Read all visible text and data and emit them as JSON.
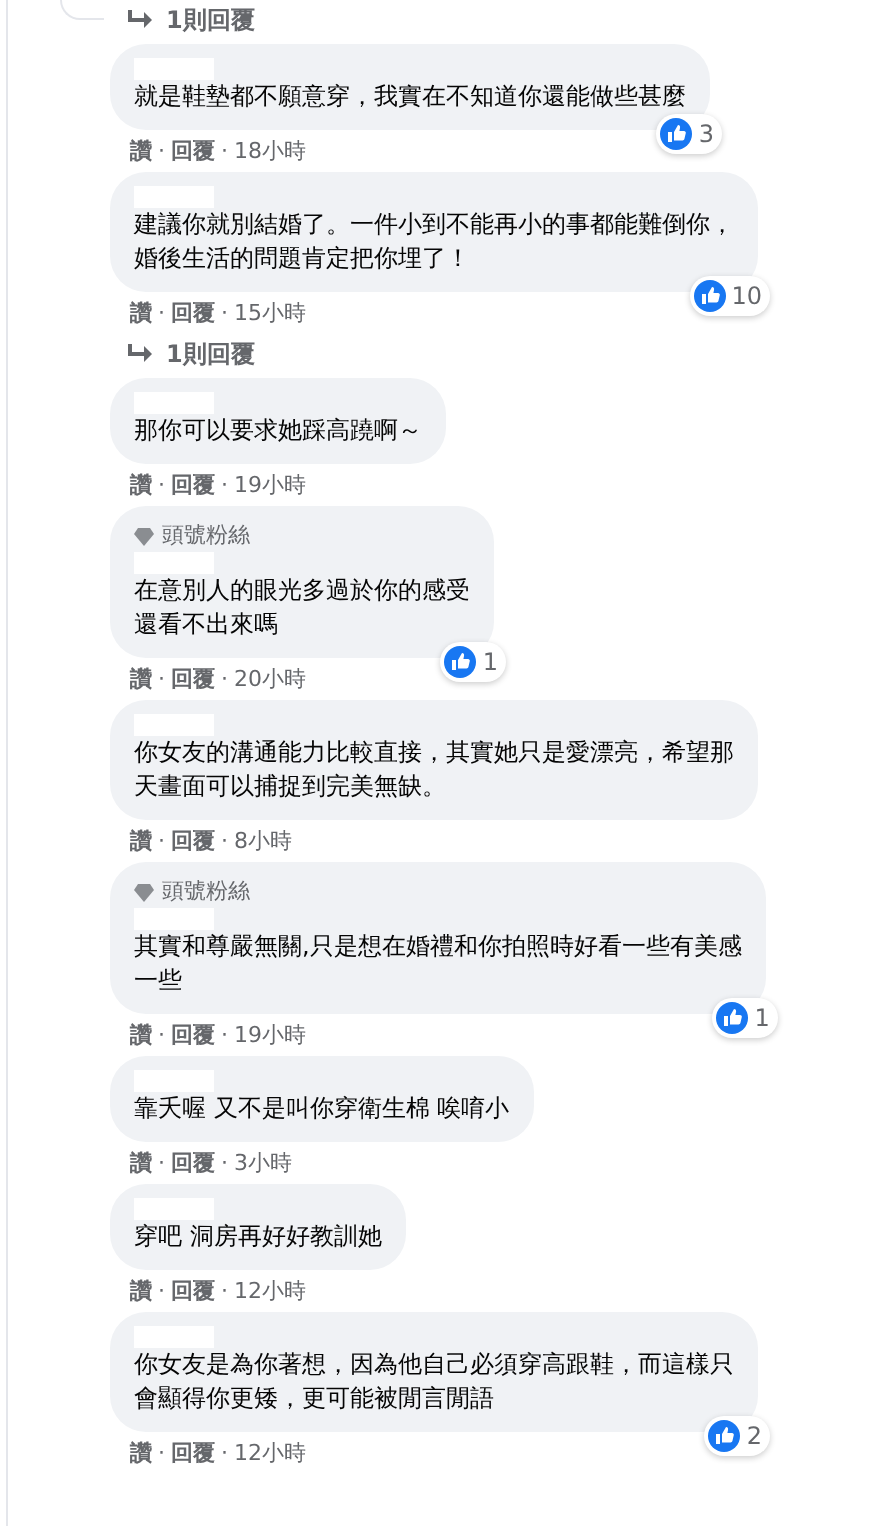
{
  "thread": [
    {
      "kind": "replies",
      "label": "1則回覆"
    },
    {
      "kind": "comment",
      "lines": [
        "就是鞋墊都不願意穿，我實在不知道你還能做些甚麼"
      ],
      "actions": [
        "讚",
        "回覆"
      ],
      "sep": "·",
      "time": "18小時",
      "likes": "3"
    },
    {
      "kind": "comment",
      "lines": [
        "建議你就別結婚了。一件小到不能再小的事都能難倒你，",
        "婚後生活的問題肯定把你埋了！"
      ],
      "actions": [
        "讚",
        "回覆"
      ],
      "sep": "·",
      "time": "15小時",
      "likes": "10"
    },
    {
      "kind": "replies",
      "label": "1則回覆"
    },
    {
      "kind": "comment",
      "lines": [
        "那你可以要求她踩高蹺啊～"
      ],
      "actions": [
        "讚",
        "回覆"
      ],
      "sep": "·",
      "time": "19小時"
    },
    {
      "kind": "comment",
      "badge": "頭號粉絲",
      "lines": [
        "在意別人的眼光多過於你的感受",
        "還看不出來嗎"
      ],
      "actions": [
        "讚",
        "回覆"
      ],
      "sep": "·",
      "time": "20小時",
      "likes": "1"
    },
    {
      "kind": "comment",
      "lines": [
        "你女友的溝通能力比較直接，其實她只是愛漂亮，希望那",
        "天畫面可以捕捉到完美無缺。"
      ],
      "actions": [
        "讚",
        "回覆"
      ],
      "sep": "·",
      "time": "8小時"
    },
    {
      "kind": "comment",
      "badge": "頭號粉絲",
      "lines": [
        "其實和尊嚴無關,只是想在婚禮和你拍照時好看一些有美感",
        "一些"
      ],
      "actions": [
        "讚",
        "回覆"
      ],
      "sep": "·",
      "time": "19小時",
      "likes": "1"
    },
    {
      "kind": "comment",
      "lines": [
        "靠夭喔 又不是叫你穿衛生棉 唉唷小"
      ],
      "actions": [
        "讚",
        "回覆"
      ],
      "sep": "·",
      "time": "3小時"
    },
    {
      "kind": "comment",
      "lines": [
        "穿吧 洞房再好好教訓她"
      ],
      "actions": [
        "讚",
        "回覆"
      ],
      "sep": "·",
      "time": "12小時"
    },
    {
      "kind": "comment",
      "lines": [
        "你女友是為你著想，因為他自己必須穿高跟鞋，而這樣只",
        "會顯得你更矮，更可能被閒言閒語"
      ],
      "actions": [
        "讚",
        "回覆"
      ],
      "sep": "·",
      "time": "12小時",
      "likes": "2"
    }
  ]
}
